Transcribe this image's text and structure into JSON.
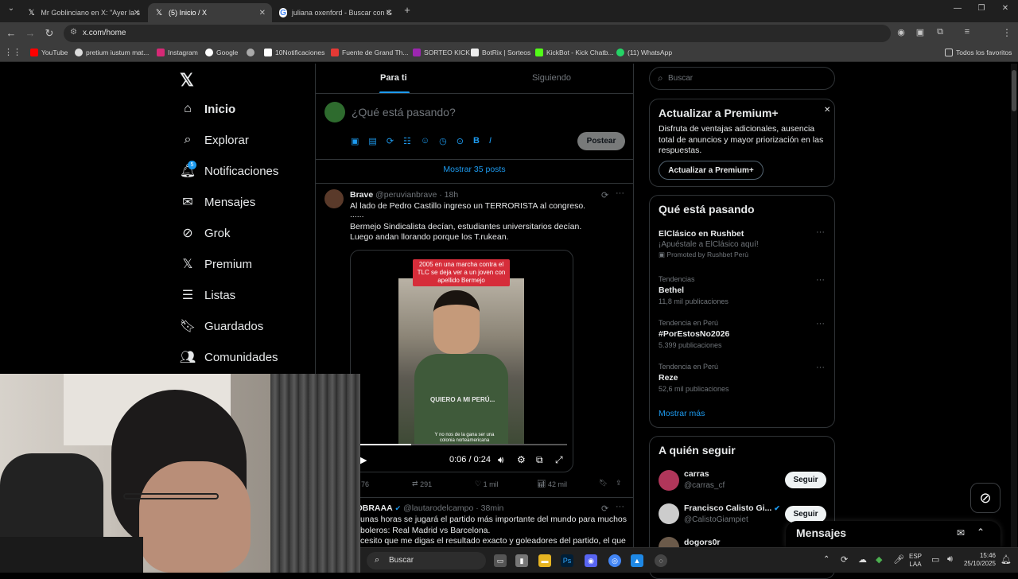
{
  "browser": {
    "tabs": [
      {
        "title": "Mr Goblinciano en X: \"Ayer la s",
        "icon": "x-logo-icon"
      },
      {
        "title": "(5) Inicio / X",
        "icon": "x-logo-icon"
      },
      {
        "title": "juliana oxenford - Buscar con G",
        "icon": "google-icon"
      }
    ],
    "url": "x.com/home",
    "bookmarks": [
      {
        "label": "YouTube",
        "color": "#ff0000"
      },
      {
        "label": "pretium iustum mat...",
        "color": "#dddddd"
      },
      {
        "label": "Instagram",
        "color": "#d62976"
      },
      {
        "label": "Google",
        "color": "#ffffff"
      },
      {
        "label": "",
        "color": "#aaaaaa"
      },
      {
        "label": "10Notificaciones",
        "color": "#ffffff"
      },
      {
        "label": "Fuente de Grand Th...",
        "color": "#e53935"
      },
      {
        "label": "SORTEO KICK",
        "color": "#9c27b0"
      },
      {
        "label": "BotRix | Sorteos",
        "color": "#eeeeee"
      },
      {
        "label": "KickBot - Kick Chatb...",
        "color": "#53fc18"
      },
      {
        "label": "(11) WhatsApp",
        "color": "#25d366"
      }
    ],
    "all_bookmarks": "Todos los favoritos"
  },
  "sidebar": {
    "items": [
      {
        "label": "Inicio",
        "icon": "home-icon",
        "glyph": "⌂"
      },
      {
        "label": "Explorar",
        "icon": "search-icon",
        "glyph": "⌕"
      },
      {
        "label": "Notificaciones",
        "icon": "bell-icon",
        "glyph": "🔔︎",
        "badge": "5"
      },
      {
        "label": "Mensajes",
        "icon": "mail-icon",
        "glyph": "✉"
      },
      {
        "label": "Grok",
        "icon": "grok-icon",
        "glyph": "⊘"
      },
      {
        "label": "Premium",
        "icon": "x-logo-icon",
        "glyph": "𝕏"
      },
      {
        "label": "Listas",
        "icon": "list-icon",
        "glyph": "☰"
      },
      {
        "label": "Guardados",
        "icon": "bookmark-icon",
        "glyph": "🔖︎"
      },
      {
        "label": "Comunidades",
        "icon": "people-icon",
        "glyph": "👥︎"
      }
    ]
  },
  "feed": {
    "tabs": [
      "Para ti",
      "Siguiendo"
    ],
    "compose_placeholder": "¿Qué está pasando?",
    "post_button": "Postear",
    "show_posts": "Mostrar 35 posts",
    "tweet1": {
      "name": "Brave",
      "handle": "@peruvianbrave · 18h",
      "lines": [
        "Al lado de Pedro Castillo ingreso un TERRORISTA al congreso.",
        "......",
        "Bermejo Sindicalista decían, estudiantes universitarios decían.",
        "Luego andan llorando porque los T.rukean."
      ],
      "video_caption": "2005 en una marcha contra el TLC se deja ver a un joven con apellido Bermejo",
      "video_shirt_text": "QUIERO A MI PERÚ...",
      "subtitle": "Y no nos de la gana ser una colonia norteamericana",
      "time": "0:06 / 0:24",
      "progress": 0.25,
      "replies": "76",
      "reposts": "291",
      "likes": "1 mil",
      "views": "42 mil"
    },
    "tweet2": {
      "name": "COBRAAA",
      "handle": "@lautarodelcampo · 38min",
      "lines": [
        "unas horas se jugará el partido más importante del mundo para muchos",
        "boleros: Real Madrid vs Barcelona.",
        "cesito que me digas el resultado exacto y goleadores del partido, el que"
      ]
    }
  },
  "right": {
    "search_placeholder": "Buscar",
    "premium": {
      "title": "Actualizar a Premium+",
      "body": "Disfruta de ventajas adicionales, ausencia total de anuncios y mayor priorización en las respuestas.",
      "button": "Actualizar a Premium+"
    },
    "trends_title": "Qué está pasando",
    "trends": [
      {
        "category": "",
        "name": "ElClásico en Rushbet",
        "sub": "¡Apuéstale a ElClásico aquí!",
        "meta": "Promoted by Rushbet Perú"
      },
      {
        "category": "Tendencias",
        "name": "Bethel",
        "sub": "",
        "meta": "11,8 mil publicaciones"
      },
      {
        "category": "Tendencia en Perú",
        "name": "#PorEstosNo2026",
        "sub": "",
        "meta": "5.399 publicaciones"
      },
      {
        "category": "Tendencia en Perú",
        "name": "Reze",
        "sub": "",
        "meta": "52,6 mil publicaciones"
      }
    ],
    "show_more": "Mostrar más",
    "follow_title": "A quién seguir",
    "follow": [
      {
        "name": "carras",
        "handle": "@carras_cf",
        "button": "Seguir"
      },
      {
        "name": "Francisco Calisto Gi...",
        "handle": "@CalistoGiampiet",
        "button": "Seguir"
      },
      {
        "name": "dogors0r",
        "handle": "",
        "button": ""
      }
    ],
    "messages_label": "Mensajes"
  },
  "taskbar": {
    "search": "Buscar",
    "lang1": "ESP",
    "lang2": "LAA",
    "time": "15:46",
    "date": "25/10/2025"
  }
}
